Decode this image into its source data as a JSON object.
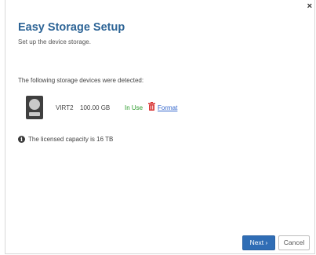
{
  "dialog": {
    "close_label": "×",
    "title": "Easy Storage Setup",
    "subtitle": "Set up the device storage."
  },
  "devices_section": {
    "heading": "The following storage devices were detected:",
    "devices": [
      {
        "name": "VIRT2",
        "size": "100.00 GB",
        "status": "In Use",
        "action_label": "Format",
        "icon": "hard-drive-icon",
        "status_color": "#2a9a2a"
      }
    ]
  },
  "license": {
    "icon": "info-icon",
    "text": "The licensed capacity is 16 TB"
  },
  "footer": {
    "next_label": "Next ›",
    "cancel_label": "Cancel"
  },
  "colors": {
    "title": "#2d6496",
    "primary_button": "#2f6db5",
    "link": "#3366cc",
    "trash": "#d93a3a"
  }
}
